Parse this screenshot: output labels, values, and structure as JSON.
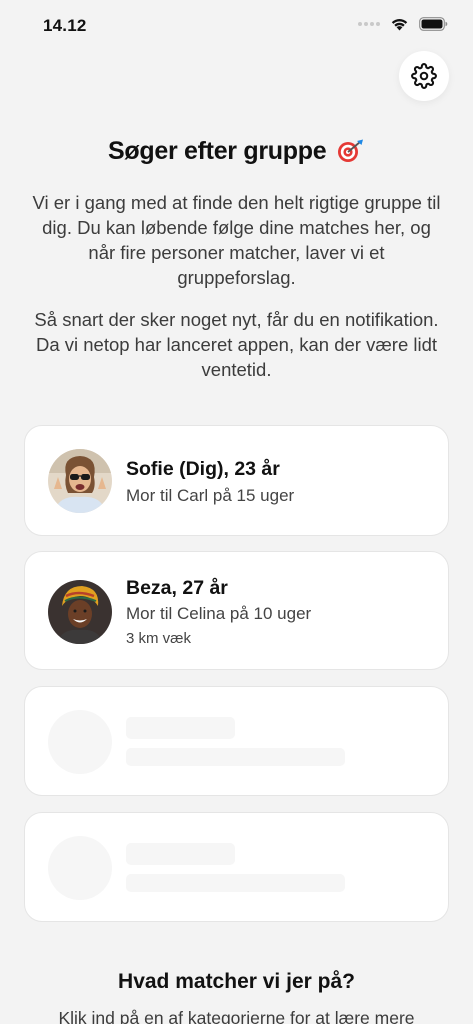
{
  "status_bar": {
    "time": "14.12"
  },
  "header": {
    "title": "Søger efter gruppe",
    "title_icon": "dart-target-icon",
    "settings_icon": "gear-icon"
  },
  "intro": {
    "paragraph1": "Vi er i gang med at finde den helt rigtige gruppe til dig. Du kan løbende følge dine matches her, og når fire personer matcher, laver vi et gruppeforslag.",
    "paragraph2": "Så snart der sker noget nyt, får du en notifikation. Da vi netop har lanceret appen, kan der være lidt ventetid."
  },
  "members": [
    {
      "name": "Sofie (Dig), 23 år",
      "subtitle": "Mor til Carl på 15 uger"
    },
    {
      "name": "Beza, 27 år",
      "subtitle": "Mor til Celina på 10 uger",
      "distance": "3 km væk"
    }
  ],
  "matching_section": {
    "title": "Hvad matcher vi jer på?",
    "subtitle": "Klik ind på en af kategorierne for at lære mere"
  },
  "colors": {
    "background": "#f3f3f3",
    "card": "#ffffff",
    "skeleton": "#f6f6f6",
    "text_primary": "#111111",
    "text_secondary": "#3c3c3c"
  }
}
